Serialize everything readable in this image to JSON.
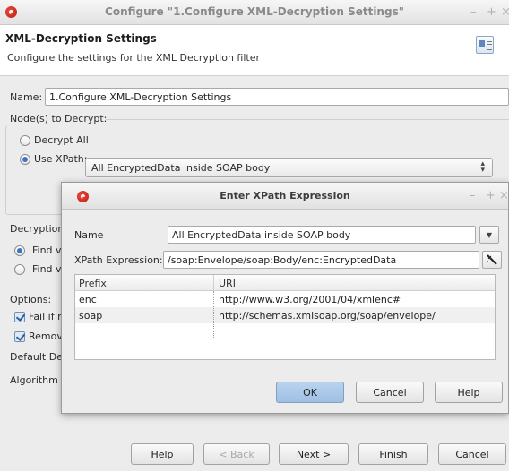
{
  "window": {
    "title": "Configure \"1.Configure XML-Decryption Settings\"",
    "controls": [
      "–",
      "+",
      "×"
    ]
  },
  "header": {
    "title": "XML-Decryption Settings",
    "description": "Configure the settings for the XML Decryption filter"
  },
  "form": {
    "name_label": "Name:",
    "name_value": "1.Configure XML-Decryption Settings",
    "nodes_label": "Node(s) to Decrypt:",
    "decrypt_all_label": "Decrypt All",
    "use_xpath_label": "Use XPath:",
    "xpath_selected": "All EncryptedData inside SOAP body",
    "decryption_label": "Decryption",
    "find1_label": "Find vi",
    "find2_label": "Find vi",
    "options_label": "Options:",
    "fail_label": "Fail if n",
    "remove_label": "Remov",
    "default_label": "Default De",
    "algorithm_label": "Algorithm"
  },
  "footer": {
    "help": "Help",
    "back": "< Back",
    "next": "Next >",
    "finish": "Finish",
    "cancel": "Cancel"
  },
  "dialog": {
    "title": "Enter XPath Expression",
    "controls": [
      "–",
      "+",
      "×"
    ],
    "name_label": "Name",
    "name_value": "All EncryptedData inside SOAP body",
    "xpath_label": "XPath Expression:",
    "xpath_value": "/soap:Envelope/soap:Body/enc:EncryptedData",
    "table": {
      "headers": [
        "Prefix",
        "URI"
      ],
      "rows": [
        {
          "prefix": "enc",
          "uri": "http://www.w3.org/2001/04/xmlenc#"
        },
        {
          "prefix": "soap",
          "uri": "http://schemas.xmlsoap.org/soap/envelope/"
        }
      ]
    },
    "ok": "OK",
    "cancel": "Cancel",
    "help": "Help"
  },
  "icons": {
    "app": "app-logo-icon",
    "doc": "document-settings-icon",
    "wand": "magic-wand-icon"
  },
  "colors": {
    "accent": "#3b76c4",
    "logo": "#c8241a",
    "primary_button": "#acc9e9"
  }
}
